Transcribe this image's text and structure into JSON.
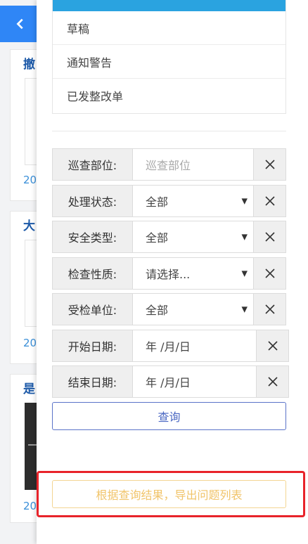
{
  "background": {
    "cards": [
      {
        "title": "撤",
        "year": "20"
      },
      {
        "title": "大",
        "year": "20"
      },
      {
        "title": "是",
        "year": "20"
      }
    ]
  },
  "drawer": {
    "status_options": [
      "草稿",
      "通知警告",
      "已发整改单"
    ],
    "filters": {
      "patrol_dept": {
        "label": "巡查部位:",
        "placeholder": "巡查部位"
      },
      "handle_status": {
        "label": "处理状态:",
        "value": "全部"
      },
      "safety_type": {
        "label": "安全类型:",
        "value": "全部"
      },
      "inspection_nature": {
        "label": "检查性质:",
        "value": "请选择..."
      },
      "inspected_unit": {
        "label": "受检单位:",
        "value": "全部"
      },
      "start_date": {
        "label": "开始日期:",
        "value": "年 /月/日"
      },
      "end_date": {
        "label": "结束日期:",
        "value": "年 /月/日"
      }
    },
    "query_button": "查询",
    "export_button": "根据查询结果，导出问题列表"
  },
  "colors": {
    "accent_blue": "#2f86f6",
    "query_border": "#5a73c8",
    "export_text": "#f1c46a",
    "highlight_red": "#e8232a"
  }
}
